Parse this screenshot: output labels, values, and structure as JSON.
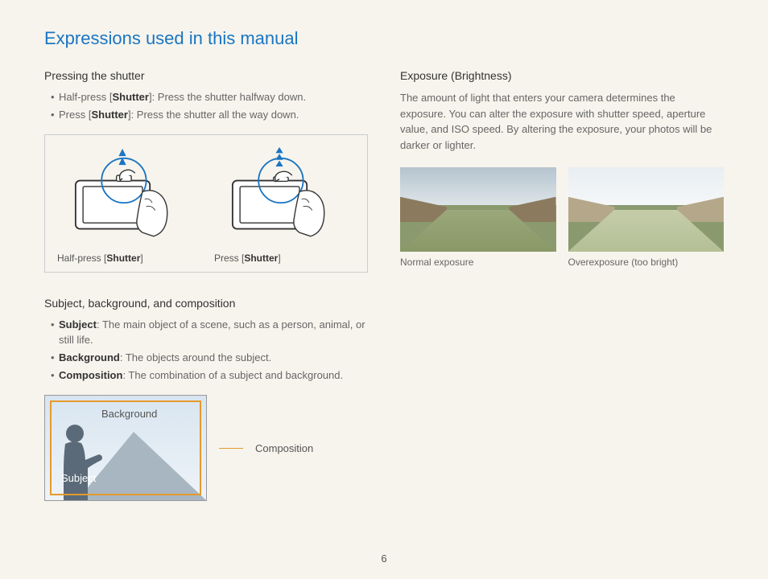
{
  "title": "Expressions used in this manual",
  "page_number": "6",
  "left": {
    "section1": {
      "heading": "Pressing the shutter",
      "items": [
        {
          "prefix": "Half-press [",
          "bold": "Shutter",
          "suffix": "]: Press the shutter halfway down."
        },
        {
          "prefix": "Press [",
          "bold": "Shutter",
          "suffix": "]: Press the shutter all the way down."
        }
      ],
      "diagram": {
        "caption1_pre": "Half-press [",
        "caption1_bold": "Shutter",
        "caption1_post": "]",
        "caption2_pre": "Press [",
        "caption2_bold": "Shutter",
        "caption2_post": "]"
      }
    },
    "section2": {
      "heading": "Subject, background, and composition",
      "items": [
        {
          "bold": "Subject",
          "suffix": ": The main object of a scene, such as a person, animal, or still life."
        },
        {
          "bold": "Background",
          "suffix": ": The objects around the subject."
        },
        {
          "bold": "Composition",
          "suffix": ": The combination of a subject and background."
        }
      ],
      "labels": {
        "background": "Background",
        "subject": "Subject",
        "composition": "Composition"
      }
    }
  },
  "right": {
    "section1": {
      "heading": "Exposure (Brightness)",
      "body": "The amount of light that enters your camera determines the exposure. You can alter the exposure with shutter speed, aperture value, and ISO speed. By altering the exposure, your photos will be darker or lighter.",
      "photo1_caption": "Normal exposure",
      "photo2_caption": "Overexposure (too bright)"
    }
  }
}
